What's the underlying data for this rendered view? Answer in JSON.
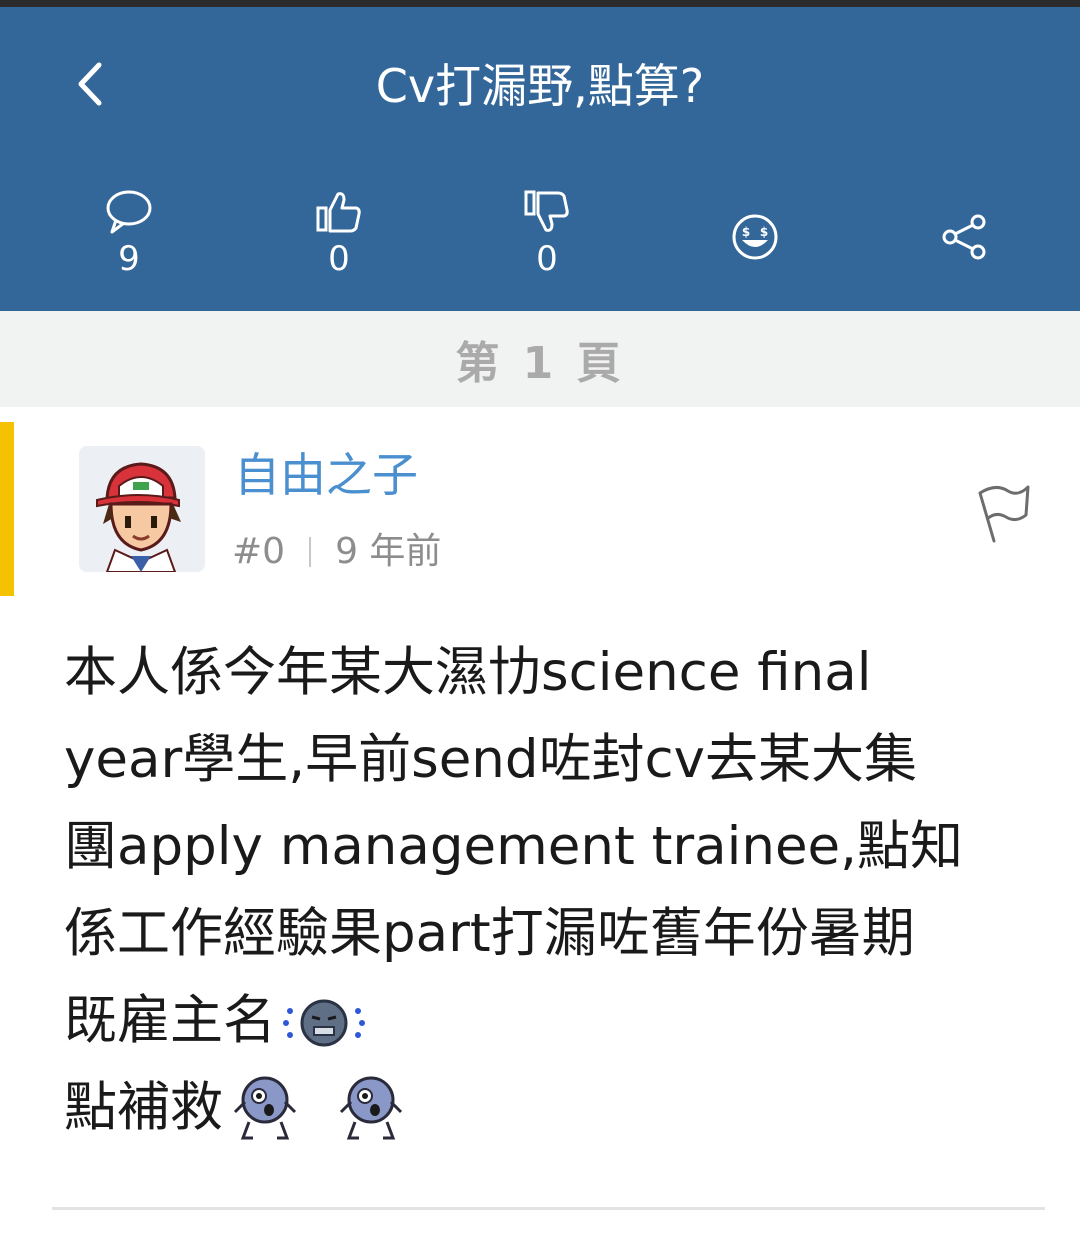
{
  "header": {
    "title": "Cv打漏野,點算?",
    "back_icon": "chevron-left-icon",
    "background_color": "#33679a",
    "actions": [
      {
        "icon": "comment-icon",
        "count": "9"
      },
      {
        "icon": "thumbs-up-icon",
        "count": "0"
      },
      {
        "icon": "thumbs-down-icon",
        "count": "0"
      },
      {
        "icon": "money-face-icon"
      },
      {
        "icon": "share-icon"
      }
    ]
  },
  "page_bar": {
    "label": "第 1 頁"
  },
  "post": {
    "author": "自由之子",
    "floor": "#0",
    "time": "9 年前",
    "highlight_color": "#f4c200",
    "lines": [
      "本人係今年某大濕㔹science final",
      "year學生,早前send咗封cv去某大集",
      "團apply management trainee,點知",
      "係工作經驗果part打漏咗舊年份暑期",
      "既雇主名",
      "點補救"
    ],
    "emojis": [
      "crying-face-emoji",
      "shocked-face-emoji",
      "shocked-face-emoji"
    ]
  }
}
